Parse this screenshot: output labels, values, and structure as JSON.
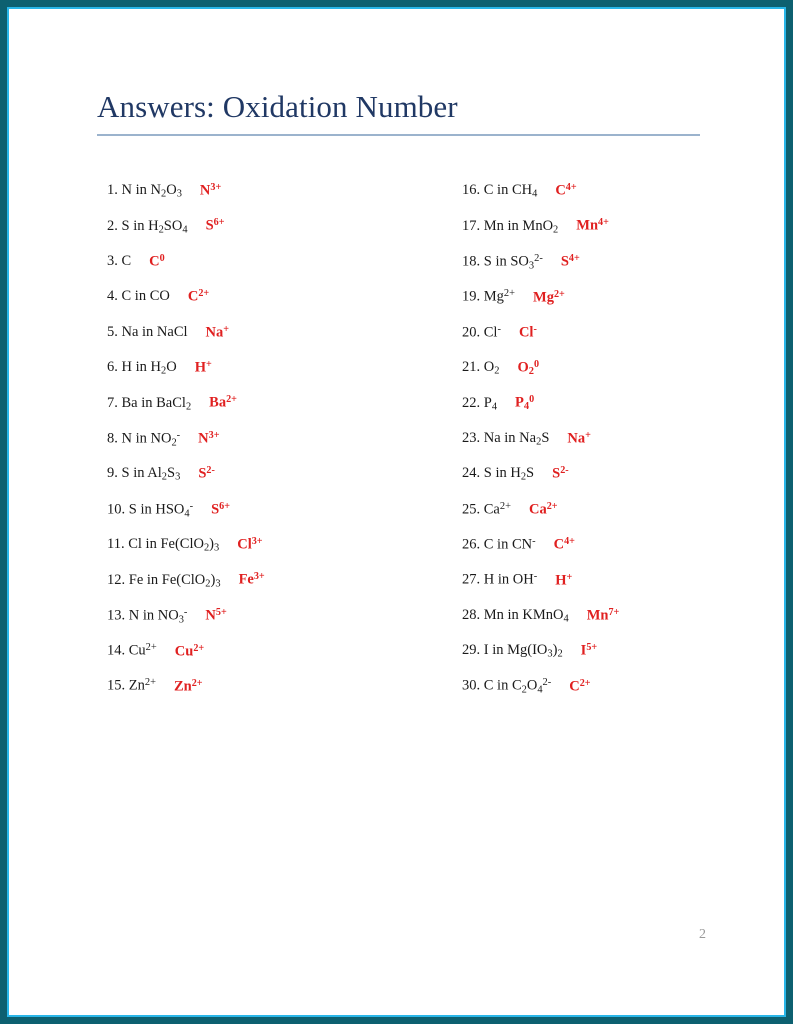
{
  "document": {
    "title": "Answers: Oxidation Number",
    "page_number": "2",
    "accent_title_color": "#203864",
    "answer_color": "#e02020",
    "rule_color": "#9bb3cd",
    "border_outer_color": "#0d6070",
    "border_inner_color": "#29b6e8"
  },
  "columns": {
    "left": [
      {
        "num": "1.",
        "question_html": "N in N<sub>2</sub>O<sub>3</sub>",
        "answer_html": "N<sup>3+</sup>"
      },
      {
        "num": "2.",
        "question_html": "S in H<sub>2</sub>SO<sub>4</sub>",
        "answer_html": "S<sup>6+</sup>"
      },
      {
        "num": "3.",
        "question_html": "C",
        "answer_html": "C<sup>0</sup>"
      },
      {
        "num": "4.",
        "question_html": "C in CO",
        "answer_html": "C<sup>2+</sup>"
      },
      {
        "num": "5.",
        "question_html": "Na in NaCl",
        "answer_html": "Na<sup>+</sup>"
      },
      {
        "num": "6.",
        "question_html": "H in H<sub>2</sub>O",
        "answer_html": "H<sup>+</sup>"
      },
      {
        "num": "7.",
        "question_html": "Ba in BaCl<sub>2</sub>",
        "answer_html": "Ba<sup>2+</sup>"
      },
      {
        "num": "8.",
        "question_html": "N in NO<sub>2</sub><sup>-</sup>",
        "answer_html": "N<sup>3+</sup>"
      },
      {
        "num": "9.",
        "question_html": "S in Al<sub>2</sub>S<sub>3</sub>",
        "answer_html": "S<sup>2-</sup>"
      },
      {
        "num": "10.",
        "question_html": "S in HSO<sub>4</sub><sup>-</sup>",
        "answer_html": "S<sup>6+</sup>"
      },
      {
        "num": "11.",
        "question_html": "Cl in Fe(ClO<sub>2</sub>)<sub>3</sub>",
        "answer_html": "Cl<sup>3+</sup>"
      },
      {
        "num": "12.",
        "question_html": "Fe in Fe(ClO<sub>2</sub>)<sub>3</sub>",
        "answer_html": "Fe<sup>3+</sup>"
      },
      {
        "num": "13.",
        "question_html": "N in NO<sub>3</sub><sup>-</sup>",
        "answer_html": "N<sup>5+</sup>"
      },
      {
        "num": "14.",
        "question_html": "Cu<sup>2+</sup>",
        "answer_html": "Cu<sup>2+</sup>"
      },
      {
        "num": "15.",
        "question_html": "Zn<sup>2+</sup>",
        "answer_html": "Zn<sup>2+</sup>"
      }
    ],
    "right": [
      {
        "num": "16.",
        "question_html": "C in CH<sub>4</sub>",
        "answer_html": "C<sup>4+</sup>"
      },
      {
        "num": "17.",
        "question_html": "Mn in MnO<sub>2</sub>",
        "answer_html": "Mn<sup>4+</sup>"
      },
      {
        "num": "18.",
        "question_html": "S in SO<sub>3</sub><sup>2-</sup>",
        "answer_html": "S<sup>4+</sup>"
      },
      {
        "num": "19.",
        "question_html": "Mg<sup>2+</sup>",
        "answer_html": "Mg<sup>2+</sup>"
      },
      {
        "num": "20.",
        "question_html": "Cl<sup>-</sup>",
        "answer_html": "Cl<sup>-</sup>"
      },
      {
        "num": "21.",
        "question_html": "O<sub>2</sub>",
        "answer_html": "O<sub>2</sub><sup>0</sup>"
      },
      {
        "num": "22.",
        "question_html": "P<sub>4</sub>",
        "answer_html": "P<sub>4</sub><sup>0</sup>"
      },
      {
        "num": "23.",
        "question_html": "Na in Na<sub>2</sub>S",
        "answer_html": "Na<sup>+</sup>"
      },
      {
        "num": "24.",
        "question_html": "S in H<sub>2</sub>S",
        "answer_html": "S<sup>2-</sup>"
      },
      {
        "num": "25.",
        "question_html": "Ca<sup>2+</sup>",
        "answer_html": "Ca<sup>2+</sup>"
      },
      {
        "num": "26.",
        "question_html": "C in CN<sup>-</sup>",
        "answer_html": "C<sup>4+</sup>"
      },
      {
        "num": "27.",
        "question_html": "H in OH<sup>-</sup>",
        "answer_html": "H<sup>+</sup>"
      },
      {
        "num": "28.",
        "question_html": "Mn in KMnO<sub>4</sub>",
        "answer_html": "Mn<sup>7+</sup>"
      },
      {
        "num": "29.",
        "question_html": "I in Mg(IO<sub>3</sub>)<sub>2</sub>",
        "answer_html": "I<sup>5+</sup>"
      },
      {
        "num": "30.",
        "question_html": "C in C<sub>2</sub>O<sub>4</sub><sup>2-</sup>",
        "answer_html": "C<sup>2+</sup>"
      }
    ]
  }
}
